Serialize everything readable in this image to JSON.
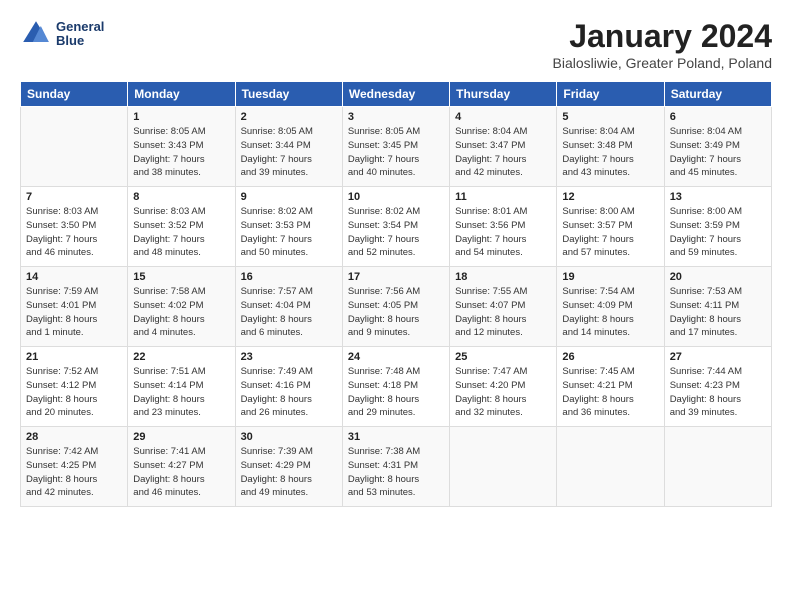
{
  "header": {
    "logo_line1": "General",
    "logo_line2": "Blue",
    "main_title": "January 2024",
    "subtitle": "Bialosliwie, Greater Poland, Poland"
  },
  "days_of_week": [
    "Sunday",
    "Monday",
    "Tuesday",
    "Wednesday",
    "Thursday",
    "Friday",
    "Saturday"
  ],
  "weeks": [
    [
      {
        "day": "",
        "info": ""
      },
      {
        "day": "1",
        "info": "Sunrise: 8:05 AM\nSunset: 3:43 PM\nDaylight: 7 hours\nand 38 minutes."
      },
      {
        "day": "2",
        "info": "Sunrise: 8:05 AM\nSunset: 3:44 PM\nDaylight: 7 hours\nand 39 minutes."
      },
      {
        "day": "3",
        "info": "Sunrise: 8:05 AM\nSunset: 3:45 PM\nDaylight: 7 hours\nand 40 minutes."
      },
      {
        "day": "4",
        "info": "Sunrise: 8:04 AM\nSunset: 3:47 PM\nDaylight: 7 hours\nand 42 minutes."
      },
      {
        "day": "5",
        "info": "Sunrise: 8:04 AM\nSunset: 3:48 PM\nDaylight: 7 hours\nand 43 minutes."
      },
      {
        "day": "6",
        "info": "Sunrise: 8:04 AM\nSunset: 3:49 PM\nDaylight: 7 hours\nand 45 minutes."
      }
    ],
    [
      {
        "day": "7",
        "info": "Sunrise: 8:03 AM\nSunset: 3:50 PM\nDaylight: 7 hours\nand 46 minutes."
      },
      {
        "day": "8",
        "info": "Sunrise: 8:03 AM\nSunset: 3:52 PM\nDaylight: 7 hours\nand 48 minutes."
      },
      {
        "day": "9",
        "info": "Sunrise: 8:02 AM\nSunset: 3:53 PM\nDaylight: 7 hours\nand 50 minutes."
      },
      {
        "day": "10",
        "info": "Sunrise: 8:02 AM\nSunset: 3:54 PM\nDaylight: 7 hours\nand 52 minutes."
      },
      {
        "day": "11",
        "info": "Sunrise: 8:01 AM\nSunset: 3:56 PM\nDaylight: 7 hours\nand 54 minutes."
      },
      {
        "day": "12",
        "info": "Sunrise: 8:00 AM\nSunset: 3:57 PM\nDaylight: 7 hours\nand 57 minutes."
      },
      {
        "day": "13",
        "info": "Sunrise: 8:00 AM\nSunset: 3:59 PM\nDaylight: 7 hours\nand 59 minutes."
      }
    ],
    [
      {
        "day": "14",
        "info": "Sunrise: 7:59 AM\nSunset: 4:01 PM\nDaylight: 8 hours\nand 1 minute."
      },
      {
        "day": "15",
        "info": "Sunrise: 7:58 AM\nSunset: 4:02 PM\nDaylight: 8 hours\nand 4 minutes."
      },
      {
        "day": "16",
        "info": "Sunrise: 7:57 AM\nSunset: 4:04 PM\nDaylight: 8 hours\nand 6 minutes."
      },
      {
        "day": "17",
        "info": "Sunrise: 7:56 AM\nSunset: 4:05 PM\nDaylight: 8 hours\nand 9 minutes."
      },
      {
        "day": "18",
        "info": "Sunrise: 7:55 AM\nSunset: 4:07 PM\nDaylight: 8 hours\nand 12 minutes."
      },
      {
        "day": "19",
        "info": "Sunrise: 7:54 AM\nSunset: 4:09 PM\nDaylight: 8 hours\nand 14 minutes."
      },
      {
        "day": "20",
        "info": "Sunrise: 7:53 AM\nSunset: 4:11 PM\nDaylight: 8 hours\nand 17 minutes."
      }
    ],
    [
      {
        "day": "21",
        "info": "Sunrise: 7:52 AM\nSunset: 4:12 PM\nDaylight: 8 hours\nand 20 minutes."
      },
      {
        "day": "22",
        "info": "Sunrise: 7:51 AM\nSunset: 4:14 PM\nDaylight: 8 hours\nand 23 minutes."
      },
      {
        "day": "23",
        "info": "Sunrise: 7:49 AM\nSunset: 4:16 PM\nDaylight: 8 hours\nand 26 minutes."
      },
      {
        "day": "24",
        "info": "Sunrise: 7:48 AM\nSunset: 4:18 PM\nDaylight: 8 hours\nand 29 minutes."
      },
      {
        "day": "25",
        "info": "Sunrise: 7:47 AM\nSunset: 4:20 PM\nDaylight: 8 hours\nand 32 minutes."
      },
      {
        "day": "26",
        "info": "Sunrise: 7:45 AM\nSunset: 4:21 PM\nDaylight: 8 hours\nand 36 minutes."
      },
      {
        "day": "27",
        "info": "Sunrise: 7:44 AM\nSunset: 4:23 PM\nDaylight: 8 hours\nand 39 minutes."
      }
    ],
    [
      {
        "day": "28",
        "info": "Sunrise: 7:42 AM\nSunset: 4:25 PM\nDaylight: 8 hours\nand 42 minutes."
      },
      {
        "day": "29",
        "info": "Sunrise: 7:41 AM\nSunset: 4:27 PM\nDaylight: 8 hours\nand 46 minutes."
      },
      {
        "day": "30",
        "info": "Sunrise: 7:39 AM\nSunset: 4:29 PM\nDaylight: 8 hours\nand 49 minutes."
      },
      {
        "day": "31",
        "info": "Sunrise: 7:38 AM\nSunset: 4:31 PM\nDaylight: 8 hours\nand 53 minutes."
      },
      {
        "day": "",
        "info": ""
      },
      {
        "day": "",
        "info": ""
      },
      {
        "day": "",
        "info": ""
      }
    ]
  ]
}
